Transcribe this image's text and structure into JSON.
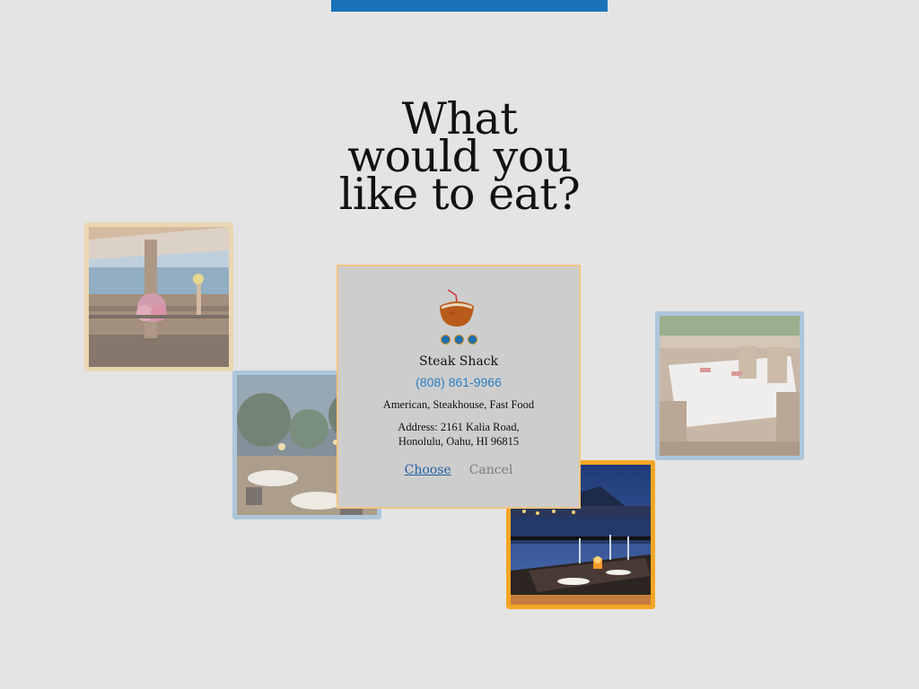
{
  "headline": {
    "line1": "What",
    "line2": "would you",
    "line3": "like to eat?"
  },
  "restaurant": {
    "name": "Steak Shack",
    "phone": "(808) 861-9966",
    "cuisine": "American, Steakhouse, Fast Food",
    "address_line1": "Address: 2161 Kalia Road,",
    "address_line2": "Honolulu, Oahu, HI 96815",
    "rating_dots": 3,
    "icon": "coconut-drink-icon"
  },
  "actions": {
    "choose_label": "Choose",
    "cancel_label": "Cancel"
  },
  "colors": {
    "background": "#e4e4e4",
    "top_bar": "#1a72b8",
    "popup_bg": "#cdcdcd",
    "popup_border": "#f0c583",
    "active_border": "#f5a623",
    "inactive_border": "#a9c6de",
    "link": "#2a7fc4",
    "choose": "#1e5fa0",
    "cancel": "#7a7a7a"
  },
  "photos": [
    {
      "name": "oceanview-terrace-photo",
      "state": "inactive"
    },
    {
      "name": "garden-patio-photo",
      "state": "inactive"
    },
    {
      "name": "banquet-table-photo",
      "state": "inactive"
    },
    {
      "name": "waterfront-dinner-photo",
      "state": "active"
    }
  ]
}
